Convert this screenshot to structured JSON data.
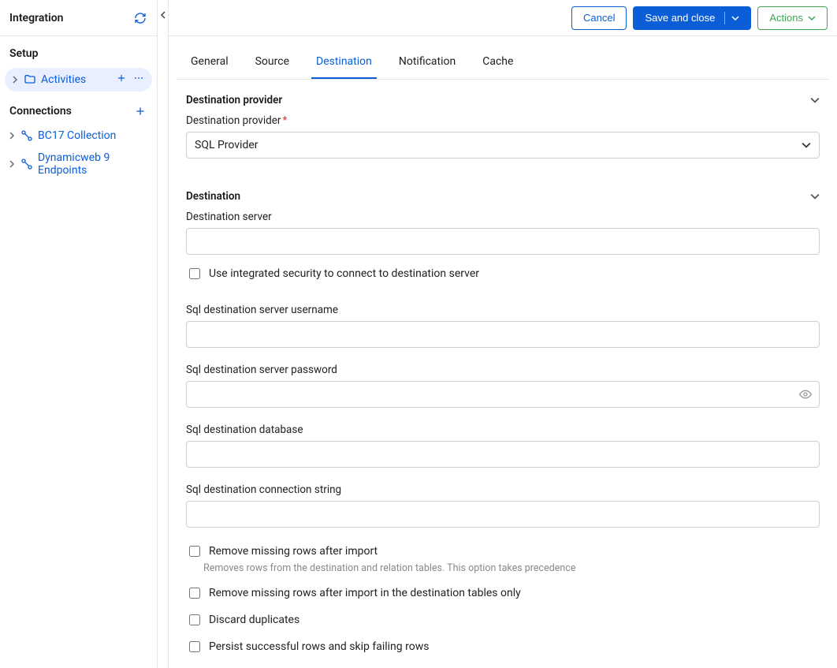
{
  "sidebar": {
    "title": "Integration",
    "sections": {
      "setup": {
        "label": "Setup",
        "items": [
          {
            "label": "Activities"
          }
        ]
      },
      "connections": {
        "label": "Connections",
        "items": [
          {
            "label": "BC17 Collection"
          },
          {
            "label": "Dynamicweb 9 Endpoints"
          }
        ]
      }
    }
  },
  "topbar": {
    "cancel": "Cancel",
    "save_close": "Save and close",
    "actions": "Actions"
  },
  "tabs": {
    "general": "General",
    "source": "Source",
    "destination": "Destination",
    "notification": "Notification",
    "cache": "Cache"
  },
  "provider_section": {
    "header": "Destination provider",
    "field_label": "Destination provider",
    "value": "SQL Provider"
  },
  "destination_section": {
    "header": "Destination",
    "server_label": "Destination server",
    "server_value": "",
    "integrated_security_label": "Use integrated security to connect to destination server",
    "username_label": "Sql destination server username",
    "username_value": "",
    "password_label": "Sql destination server password",
    "password_value": "",
    "database_label": "Sql destination database",
    "database_value": "",
    "connstring_label": "Sql destination connection string",
    "connstring_value": "",
    "remove_missing_label": "Remove missing rows after import",
    "remove_missing_help": "Removes rows from the destination and relation tables. This option takes precedence",
    "remove_missing_dest_only_label": "Remove missing rows after import in the destination tables only",
    "discard_duplicates_label": "Discard duplicates",
    "persist_label": "Persist successful rows and skip failing rows"
  }
}
